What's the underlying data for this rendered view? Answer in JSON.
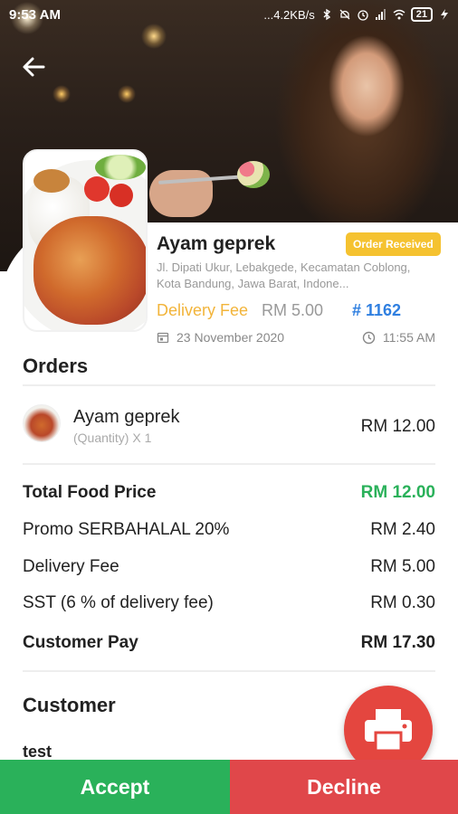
{
  "status_bar": {
    "time": "9:53 AM",
    "network_speed": "...4.2KB/s",
    "battery": "21"
  },
  "restaurant": {
    "name": "Ayam geprek",
    "status_badge": "Order Received",
    "address": "Jl. Dipati Ukur, Lebakgede, Kecamatan Coblong, Kota Bandung, Jawa Barat, Indone...",
    "delivery_fee_label": "Delivery Fee",
    "delivery_fee_value": "RM 5.00",
    "order_number": "# 1162",
    "date": "23 November 2020",
    "time": "11:55 AM"
  },
  "orders": {
    "title": "Orders",
    "items": [
      {
        "name": "Ayam geprek",
        "quantity": "(Quantity) X 1",
        "price": "RM 12.00"
      }
    ]
  },
  "summary": [
    {
      "label": "Total Food Price",
      "value": "RM 12.00"
    },
    {
      "label": "Promo SERBAHALAL 20%",
      "value": "RM 2.40"
    },
    {
      "label": "Delivery Fee",
      "value": "RM 5.00"
    },
    {
      "label": "SST (6 % of delivery fee)",
      "value": "RM 0.30"
    },
    {
      "label": "Customer Pay",
      "value": "RM 17.30"
    }
  ],
  "customer": {
    "title": "Customer",
    "name": "test"
  },
  "actions": {
    "accept": "Accept",
    "decline": "Decline"
  },
  "colors": {
    "accept": "#2ab15a",
    "decline": "#e0474a",
    "badge": "#f5c230",
    "order_number": "#2f7fe0",
    "delivery_fee": "#f2b43a",
    "print_fab": "#e4463f"
  }
}
